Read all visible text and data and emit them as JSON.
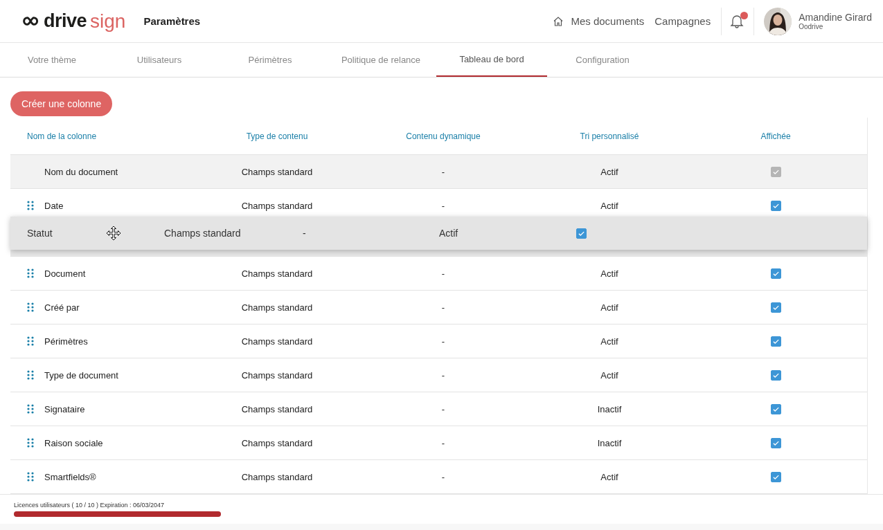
{
  "logo": {
    "name": "drive",
    "suffix": "sign"
  },
  "page_title": "Paramètres",
  "nav": [
    {
      "label": "Mes documents"
    },
    {
      "label": "Campagnes"
    }
  ],
  "notifications": {
    "unread": true
  },
  "user": {
    "name": "Amandine Girard",
    "company": "Oodrive"
  },
  "tabs": [
    {
      "label": "Votre thème",
      "selected": false
    },
    {
      "label": "Utilisateurs",
      "selected": false
    },
    {
      "label": "Périmètres",
      "selected": false
    },
    {
      "label": "Politique de relance",
      "selected": false
    },
    {
      "label": "Tableau de bord",
      "selected": true
    },
    {
      "label": "Configuration",
      "selected": false
    }
  ],
  "create_button": "Créer une colonne",
  "table": {
    "columns": [
      "Nom de la colonne",
      "Type de contenu",
      "Contenu dynamique",
      "Tri personnalisé",
      "Affichée"
    ],
    "rows": [
      {
        "kind": "locked",
        "name": "Nom du document",
        "type": "Champs standard",
        "dynamic": "-",
        "sort": "Actif",
        "checked": true,
        "disabled": true
      },
      {
        "kind": "draggable",
        "name": "Date",
        "type": "Champs standard",
        "dynamic": "-",
        "sort": "Actif",
        "checked": true,
        "disabled": false
      },
      {
        "kind": "placeholder"
      },
      {
        "kind": "draggable",
        "name": "Document",
        "type": "Champs standard",
        "dynamic": "-",
        "sort": "Actif",
        "checked": true,
        "disabled": false
      },
      {
        "kind": "draggable",
        "name": "Créé par",
        "type": "Champs standard",
        "dynamic": "-",
        "sort": "Actif",
        "checked": true,
        "disabled": false
      },
      {
        "kind": "draggable",
        "name": "Périmètres",
        "type": "Champs standard",
        "dynamic": "-",
        "sort": "Actif",
        "checked": true,
        "disabled": false
      },
      {
        "kind": "draggable",
        "name": "Type de document",
        "type": "Champs standard",
        "dynamic": "-",
        "sort": "Actif",
        "checked": true,
        "disabled": false
      },
      {
        "kind": "draggable",
        "name": "Signataire",
        "type": "Champs standard",
        "dynamic": "-",
        "sort": "Inactif",
        "checked": true,
        "disabled": false
      },
      {
        "kind": "draggable",
        "name": "Raison sociale",
        "type": "Champs standard",
        "dynamic": "-",
        "sort": "Inactif",
        "checked": true,
        "disabled": false
      },
      {
        "kind": "draggable",
        "name": "Smartfields®",
        "type": "Champs standard",
        "dynamic": "-",
        "sort": "Actif",
        "checked": true,
        "disabled": false
      }
    ],
    "dragged_row": {
      "name": "Statut",
      "type": "Champs standard",
      "dynamic": "-",
      "sort": "Actif",
      "checked": true
    }
  },
  "license": {
    "text": "Licences utilisateurs ( 10 / 10 ) Expiration : 06/03/2047",
    "level": 1.0
  }
}
